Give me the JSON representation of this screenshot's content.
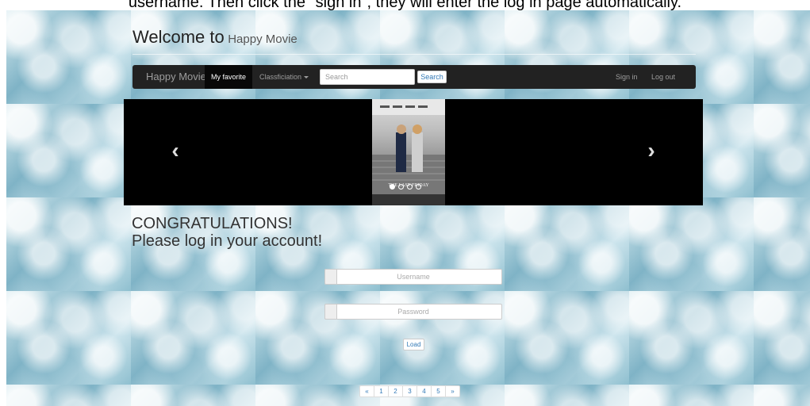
{
  "caption": "username. Then click the \"sign in\", they will enter the log in page automatically.",
  "header": {
    "welcome": "Welcome to",
    "brand_suffix": "Happy Movie"
  },
  "navbar": {
    "brand": "Happy Movie",
    "my_favorite": "My favorite",
    "classification": "Classficiation",
    "search_placeholder": "Search",
    "search_button": "Search",
    "sign_in": "Sign in",
    "log_out": "Log out"
  },
  "carousel": {
    "prev": "‹",
    "next": "›",
    "poster_title": "THE LAST FRIDAY"
  },
  "login": {
    "line1": "CONGRATULATIONS!",
    "line2": "Please log in your account!",
    "username_placeholder": "Username",
    "password_placeholder": "Password",
    "load_button": "Load"
  },
  "pagination": {
    "prev": "«",
    "pages": [
      "1",
      "2",
      "3",
      "4",
      "5"
    ],
    "next": "»"
  }
}
